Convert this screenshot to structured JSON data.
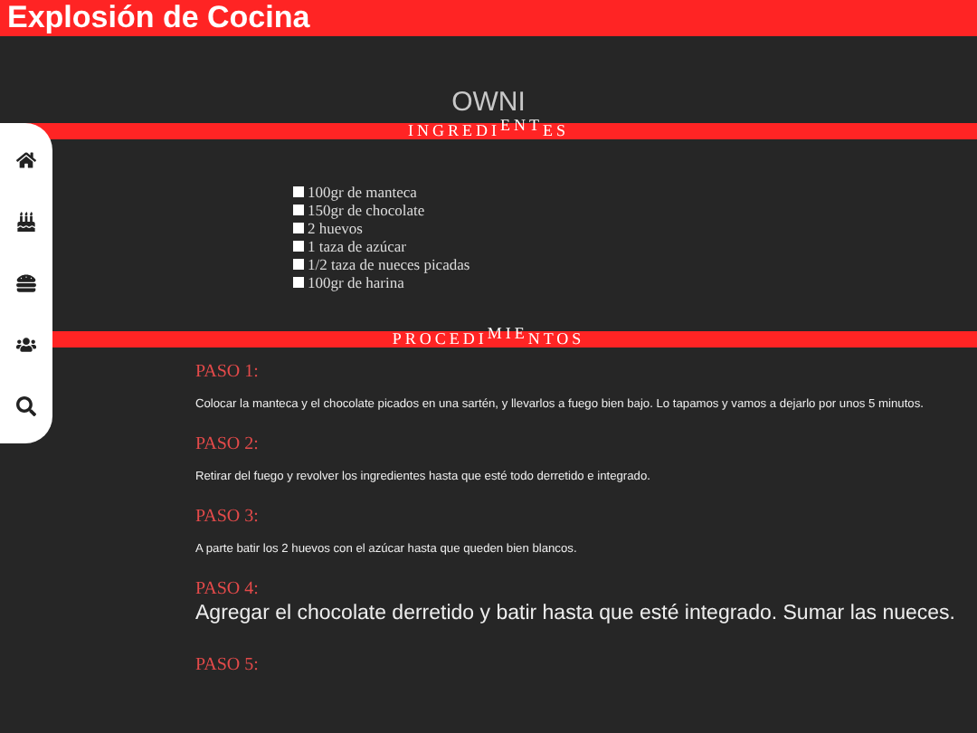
{
  "header": {
    "title": "Explosión de Cocina"
  },
  "sidebar": {
    "items": [
      {
        "kind": "home"
      },
      {
        "kind": "cake"
      },
      {
        "kind": "burger"
      },
      {
        "kind": "users"
      },
      {
        "kind": "search"
      }
    ]
  },
  "recipe_title": "OWNI",
  "ingredients": {
    "heading": "INGREDI$^{ENT}$ES",
    "items": [
      "100gr de manteca",
      "150gr de chocolate",
      "2 huevos",
      "1 taza de azúcar",
      "1/2 taza de nueces picadas",
      "100gr de harina"
    ]
  },
  "procedure": {
    "heading": "PROCEDI$^{MIE}$NTOS",
    "steps": [
      {
        "label": "PASO 1:",
        "kind": "normal",
        "text": "Colocar la manteca y el chocolate picados en una sartén, y llevarlos a fuego bien bajo. Lo tapamos y vamos a dejarlo por unos 5 minutos."
      },
      {
        "label": "PASO 2:",
        "kind": "normal",
        "text": "Retirar del fuego y revolver los ingredientes hasta que esté todo derretido e integrado."
      },
      {
        "label": "PASO 3:",
        "kind": "normal",
        "text": "A parte batir los 2 huevos con el azúcar hasta que queden bien blancos."
      },
      {
        "label": "PASO 4:",
        "kind": "large",
        "text": "Agregar el chocolate derretido y batir hasta que esté integrado. Sumar las nueces."
      },
      {
        "label": "PASO 5:",
        "kind": "normal"
      }
    ]
  }
}
